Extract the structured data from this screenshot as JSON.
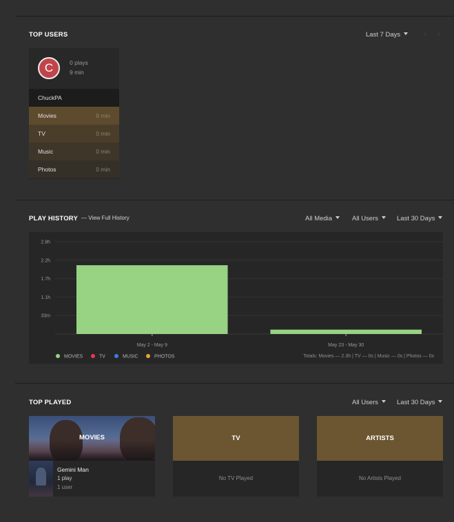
{
  "top_users": {
    "title": "TOP USERS",
    "range_label": "Last 7 Days",
    "user": {
      "initial": "C",
      "plays": "0 plays",
      "time": "9 min",
      "name": "ChuckPA",
      "avatar_color": "#c0454b"
    },
    "media": [
      {
        "label": "Movies",
        "value": "9 min",
        "color": "#5e4b2d"
      },
      {
        "label": "TV",
        "value": "0 min",
        "color": "#4a3e2b"
      },
      {
        "label": "Music",
        "value": "0 min",
        "color": "#3e3628"
      },
      {
        "label": "Photos",
        "value": "0 min",
        "color": "#342f27"
      }
    ]
  },
  "play_history": {
    "title": "PLAY HISTORY",
    "link": "— View Full History",
    "filters": {
      "media": "All Media",
      "users": "All Users",
      "range": "Last 30 Days"
    },
    "legend": [
      {
        "label": "MOVIES",
        "color": "#97d383"
      },
      {
        "label": "TV",
        "color": "#e8365d"
      },
      {
        "label": "MUSIC",
        "color": "#3c7de0"
      },
      {
        "label": "PHOTOS",
        "color": "#e8a33c"
      }
    ],
    "totals": "Totals: Movies — 2.3h | TV — 0s | Music — 0s | Photos — 0s"
  },
  "chart_data": {
    "type": "bar",
    "categories": [
      "May 2 - May 9",
      "May 23 - May 30"
    ],
    "series": [
      {
        "name": "MOVIES",
        "values": [
          2.05,
          0.13
        ],
        "color": "#97d383"
      },
      {
        "name": "TV",
        "values": [
          0,
          0
        ],
        "color": "#e8365d"
      },
      {
        "name": "MUSIC",
        "values": [
          0,
          0
        ],
        "color": "#3c7de0"
      },
      {
        "name": "PHOTOS",
        "values": [
          0,
          0
        ],
        "color": "#e8a33c"
      }
    ],
    "y_ticks": [
      "33m",
      "1.1h",
      "1.7h",
      "2.2h",
      "2.8h"
    ],
    "y_tick_values": [
      0.55,
      1.1,
      1.65,
      2.2,
      2.75
    ],
    "ylim": [
      0,
      2.75
    ],
    "grid": true,
    "legend_position": "bottom-left"
  },
  "top_played": {
    "title": "TOP PLAYED",
    "filters": {
      "users": "All Users",
      "range": "Last 30 Days"
    },
    "movies": {
      "label": "MOVIES",
      "item_title": "Gemini Man",
      "plays": "1 play",
      "users": "1 user"
    },
    "tv": {
      "label": "TV",
      "empty": "No TV Played"
    },
    "artists": {
      "label": "ARTISTS",
      "empty": "No Artists Played"
    }
  }
}
